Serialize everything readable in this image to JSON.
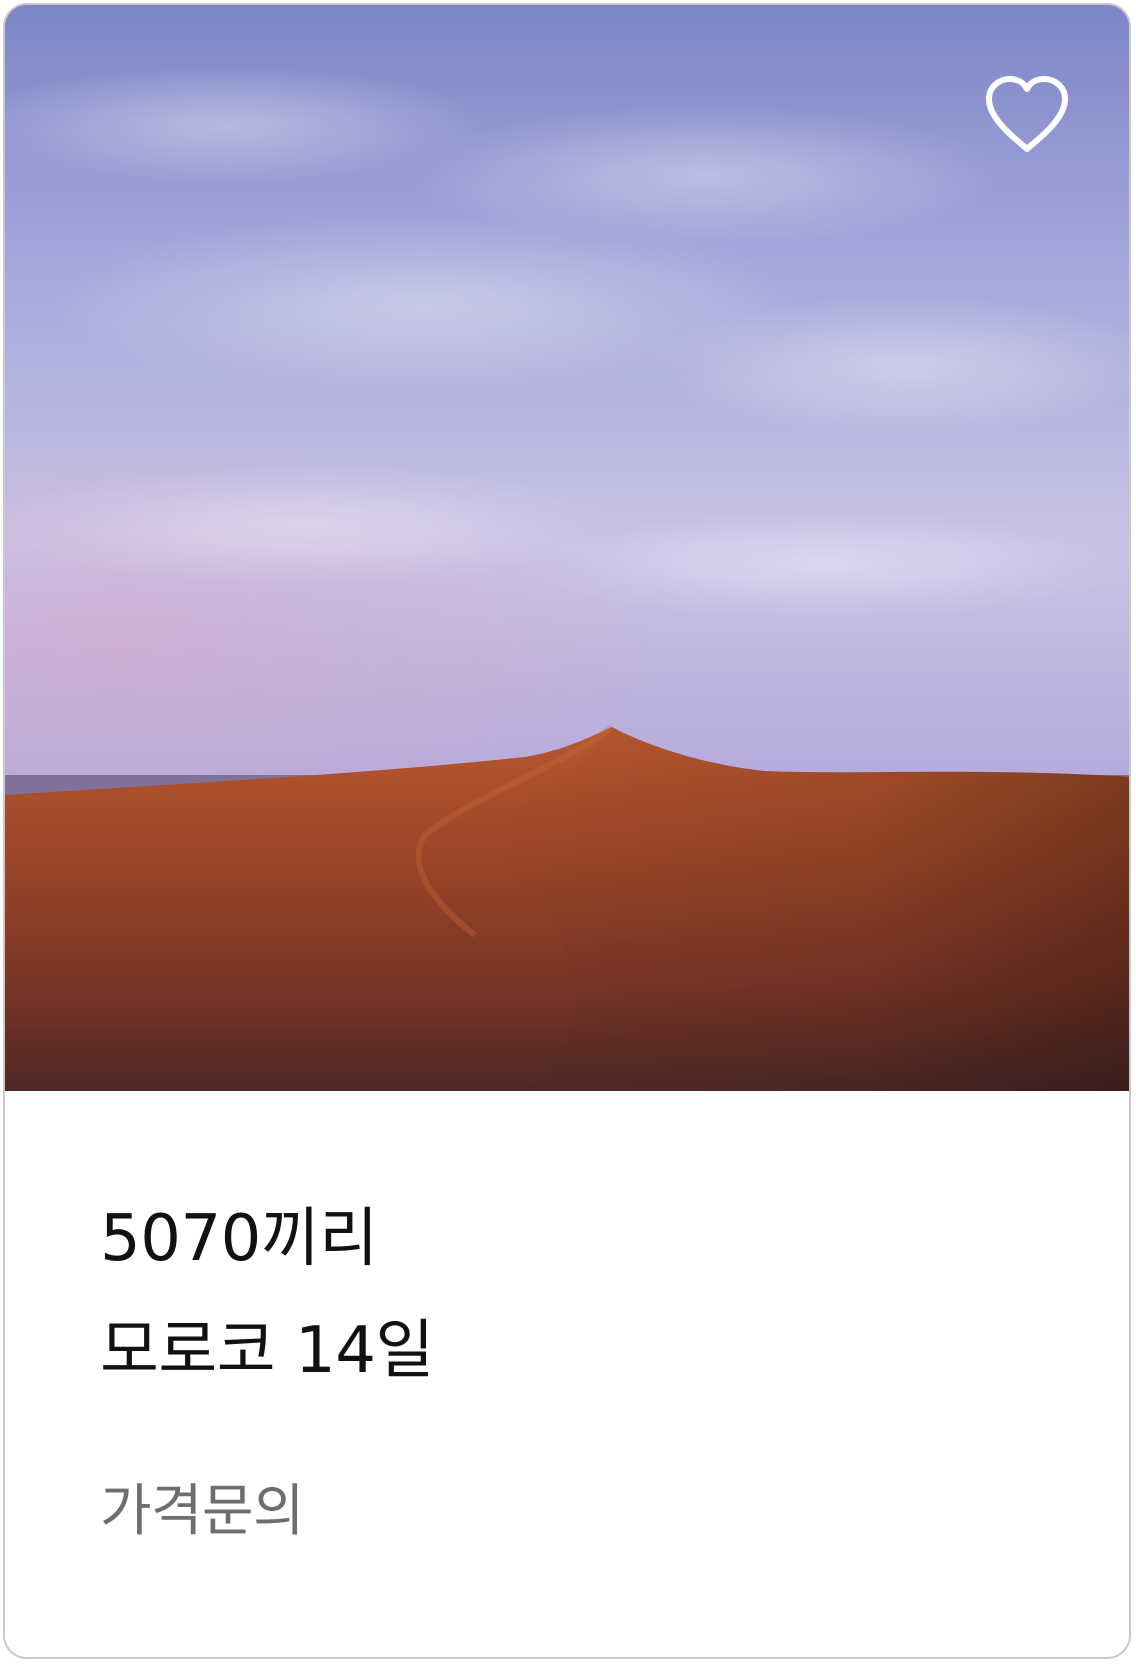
{
  "card": {
    "title": "5070끼리\n모로코 14일",
    "price_label": "가격문의",
    "image": "desert sand dune under purple cloudy sky",
    "favorite_icon": "heart-outline-icon"
  }
}
